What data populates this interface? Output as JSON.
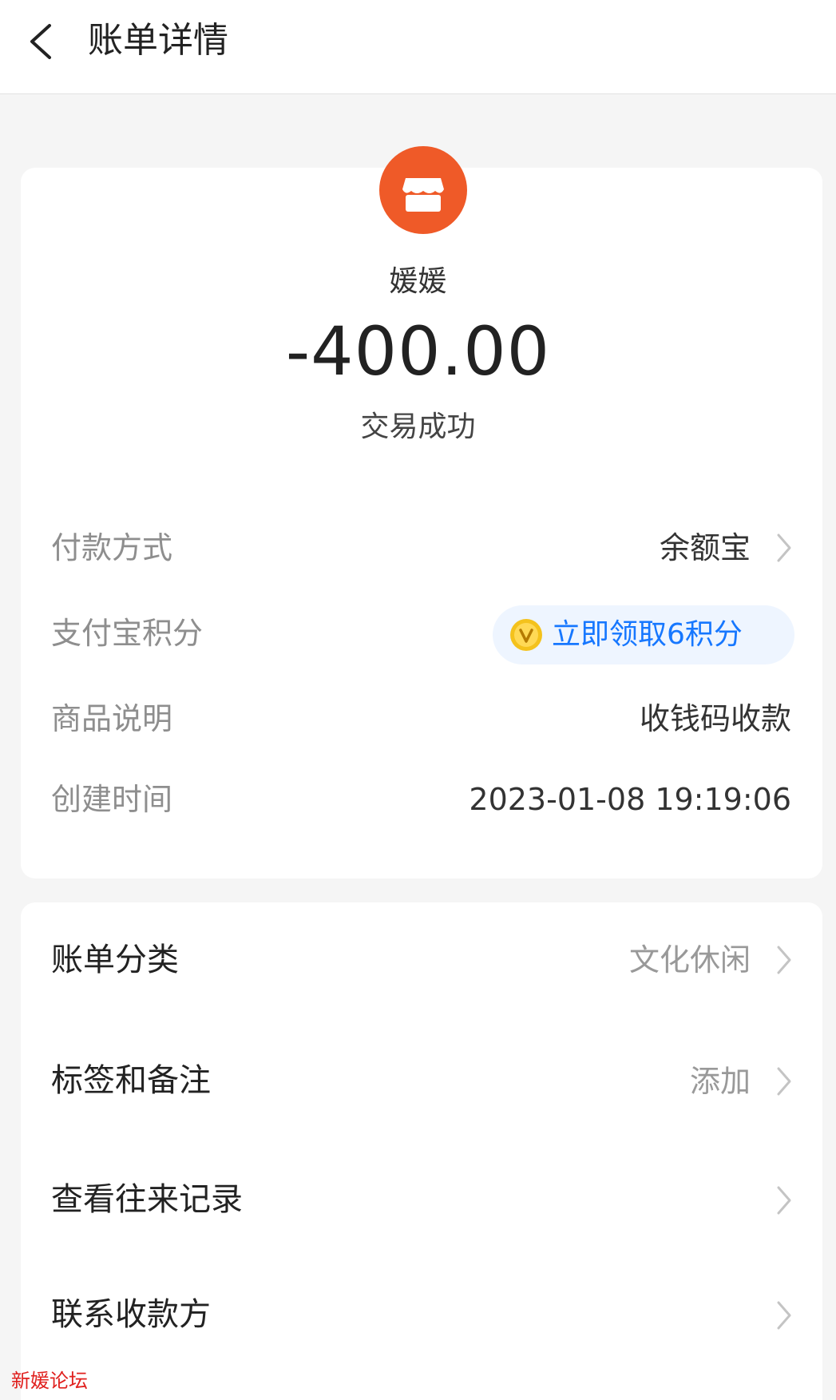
{
  "header": {
    "title": "账单详情"
  },
  "merchant": {
    "name": "媛媛",
    "logo_icon": "store-icon",
    "logo_color": "#ef5a28"
  },
  "transaction": {
    "amount": "-400.00",
    "status": "交易成功"
  },
  "details": [
    {
      "label": "付款方式",
      "value": "余额宝"
    },
    {
      "label": "支付宝积分",
      "value": "立即领取6积分"
    },
    {
      "label": "商品说明",
      "value": "收钱码收款"
    },
    {
      "label": "创建时间",
      "value": "2023-01-08 19:19:06"
    }
  ],
  "actions": [
    {
      "label": "账单分类",
      "value": "文化休闲"
    },
    {
      "label": "标签和备注",
      "value": "添加"
    },
    {
      "label": "查看往来记录"
    },
    {
      "label": "联系收款方"
    }
  ],
  "watermark": "新媛论坛",
  "colors": {
    "accent_blue": "#1677ff",
    "brand_orange": "#ef5a28",
    "label_gray": "#8e8e8e",
    "watermark_red": "#e0201e"
  }
}
